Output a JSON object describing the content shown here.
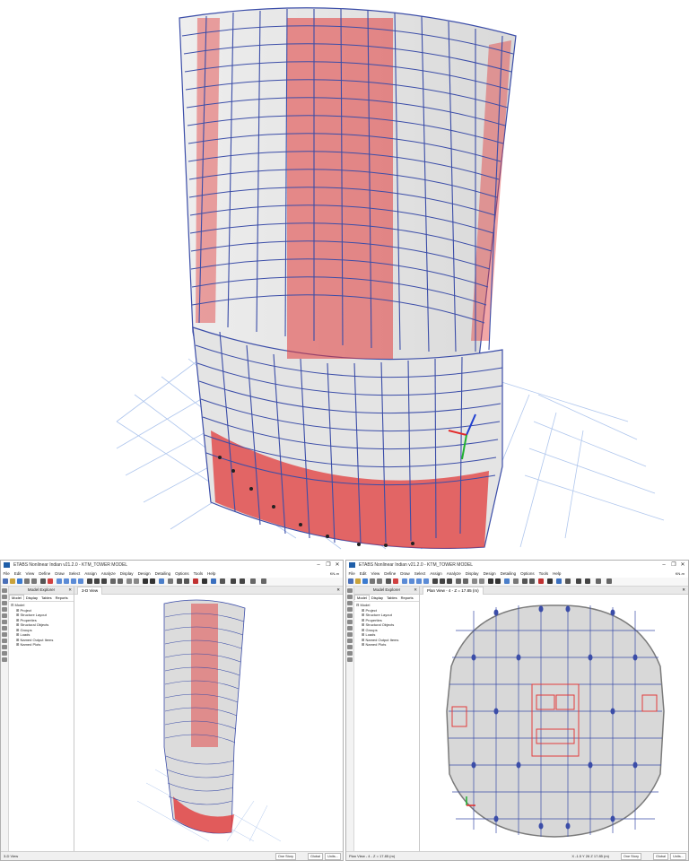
{
  "app": {
    "title": "ETABS Nonlinear Indian v21.2.0 - KTM_TOWER MODEL",
    "icon": "etabs-app-icon"
  },
  "menu": [
    "File",
    "Edit",
    "View",
    "Define",
    "Draw",
    "Select",
    "Assign",
    "Analyze",
    "Display",
    "Design",
    "Detailing",
    "Options",
    "Tools",
    "Help"
  ],
  "units_label": "KN-m",
  "window_controls": {
    "minimize": "–",
    "restore": "❐",
    "close": "✕"
  },
  "explorer": {
    "title": "Model Explorer",
    "close": "✕",
    "tabs": [
      "Model",
      "Display",
      "Tables",
      "Reports"
    ],
    "root": "Model",
    "items": [
      "Project",
      "Structure Layout",
      "Properties",
      "Structural Objects",
      "Groups",
      "Loads",
      "Named Output Items",
      "Named Plots"
    ]
  },
  "left_window": {
    "view_tab": "3-D View",
    "view_close": "✕",
    "status": "3-D View"
  },
  "right_window": {
    "view_tab": "Plan View - 4 - Z = 17.85 (m)",
    "view_close": "✕",
    "status": "Plan View - 4 - Z = 17.85 (m)",
    "coords": "X -1.5  Y 26  Z 17.85 (m)"
  },
  "status_controls": {
    "story": "One Story",
    "system": "Global",
    "units": "Units..."
  },
  "colors": {
    "frame": "#3b4da8",
    "wall": "#e23b3b",
    "slab": "#d8d8d8",
    "grid": "#9bb8e8"
  }
}
